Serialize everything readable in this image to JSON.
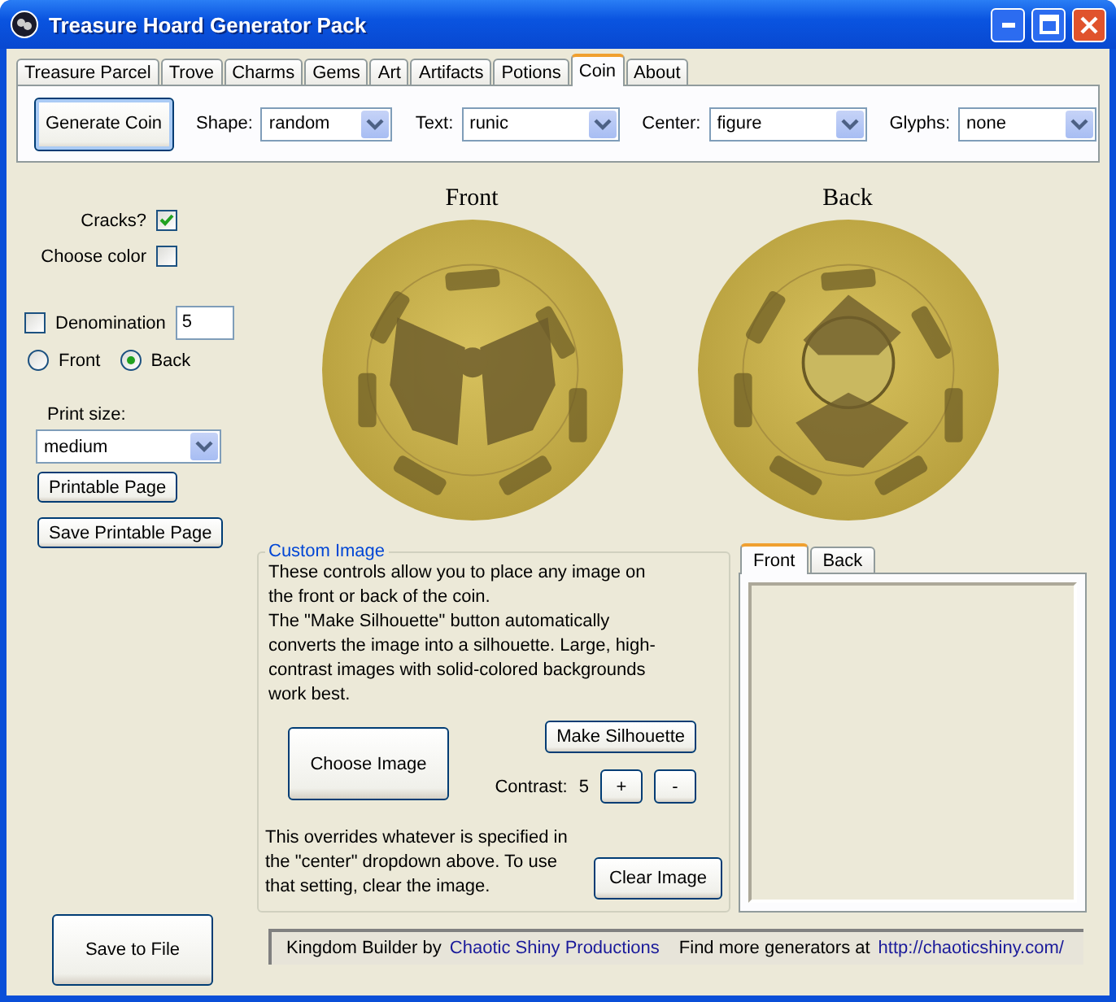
{
  "window": {
    "title": "Treasure Hoard Generator Pack"
  },
  "tabs": [
    {
      "label": "Treasure Parcel",
      "selected": false
    },
    {
      "label": "Trove",
      "selected": false
    },
    {
      "label": "Charms",
      "selected": false
    },
    {
      "label": "Gems",
      "selected": false
    },
    {
      "label": "Art",
      "selected": false
    },
    {
      "label": "Artifacts",
      "selected": false
    },
    {
      "label": "Potions",
      "selected": false
    },
    {
      "label": "Coin",
      "selected": true
    },
    {
      "label": "About",
      "selected": false
    }
  ],
  "toolbar": {
    "generate_button": "Generate Coin",
    "dropdowns": [
      {
        "label": "Shape:",
        "value": "random"
      },
      {
        "label": "Text:",
        "value": "runic"
      },
      {
        "label": "Center:",
        "value": "figure"
      },
      {
        "label": "Glyphs:",
        "value": "none"
      }
    ]
  },
  "options": {
    "cracks": {
      "label": "Cracks?",
      "checked": true
    },
    "choose_color": {
      "label": "Choose color",
      "checked": false
    },
    "denomination": {
      "label": "Denomination",
      "checked": false,
      "value": "5"
    },
    "sides": [
      {
        "label": "Front",
        "selected": false
      },
      {
        "label": "Back",
        "selected": true
      }
    ],
    "print_size": {
      "label": "Print size:",
      "value": "medium"
    },
    "buttons": [
      "Printable Page",
      "Save Printable Page"
    ],
    "save_button": "Save to File"
  },
  "coins": [
    {
      "label": "Front",
      "kind": "picture"
    },
    {
      "label": "Back",
      "kind": "picture"
    }
  ],
  "custom_image": {
    "title": "Custom Image",
    "paragraphs": [
      "These controls allow you to place any image on the front or back of the coin.",
      "The \"Make Silhouette\" button automatically converts the image into a silhouette. Large, high-contrast  images with solid-colored backgrounds work best."
    ],
    "choose_button": "Choose Image",
    "silhouette_button": "Make Silhouette",
    "contrast": {
      "label": "Contrast:",
      "value": "5",
      "plus": "+",
      "minus": "-"
    },
    "note": "This overrides whatever is specified in the \"center\" dropdown above. To use that setting, clear the image.",
    "clear_button": "Clear Image"
  },
  "preview": {
    "tabs": [
      {
        "label": "Front",
        "selected": true
      },
      {
        "label": "Back",
        "selected": false
      }
    ]
  },
  "footer": {
    "credit": "Kingdom Builder by",
    "credit_link": "Chaotic Shiny Productions",
    "more": "Find more generators at",
    "more_link": "http://chaoticshiny.com/"
  }
}
